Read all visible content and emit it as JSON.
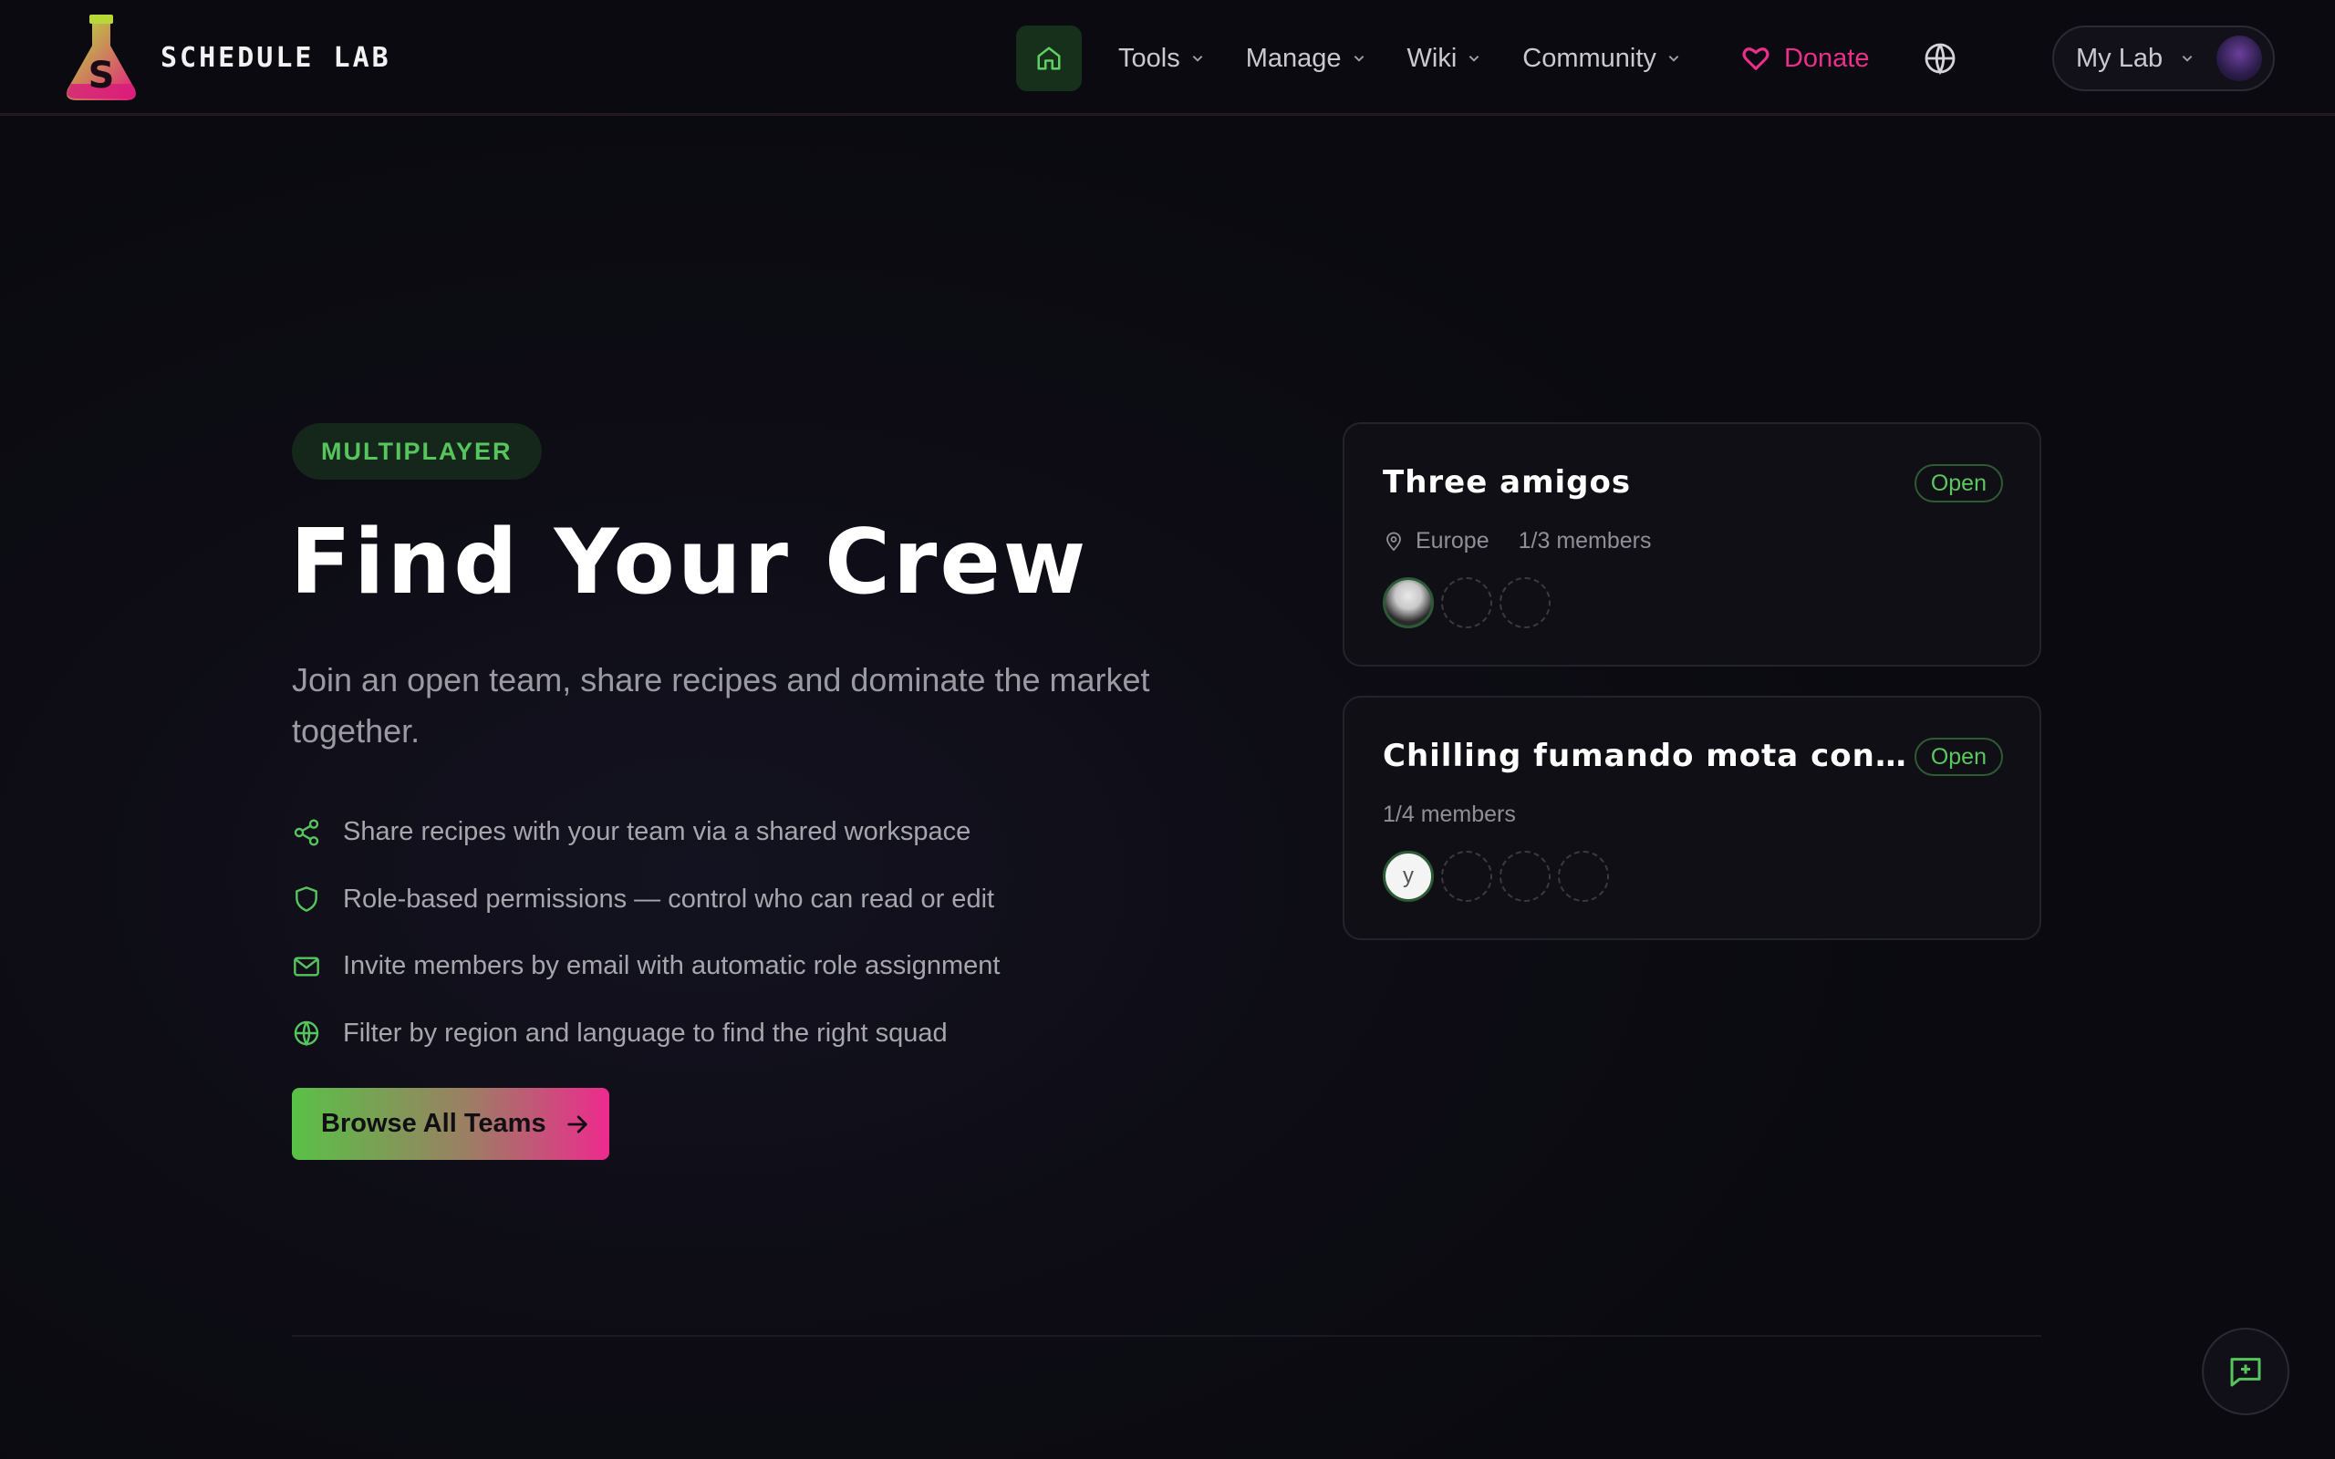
{
  "brand": {
    "name": "SCHEDULE LAB"
  },
  "nav": {
    "items": [
      {
        "label": "Tools"
      },
      {
        "label": "Manage"
      },
      {
        "label": "Wiki"
      },
      {
        "label": "Community"
      }
    ],
    "donate_label": "Donate",
    "account_label": "My Lab"
  },
  "hero": {
    "badge": "MULTIPLAYER",
    "title": "Find Your Crew",
    "subtitle": "Join an open team, share recipes and dominate the market together.",
    "features": [
      {
        "icon": "share-icon",
        "text": "Share recipes with your team via a shared workspace"
      },
      {
        "icon": "shield-icon",
        "text": "Role-based permissions — control who can read or edit"
      },
      {
        "icon": "mail-icon",
        "text": "Invite members by email with automatic role assignment"
      },
      {
        "icon": "globe-icon",
        "text": "Filter by region and language to find the right squad"
      }
    ],
    "cta_label": "Browse All Teams"
  },
  "teams": [
    {
      "name": "Three amigos",
      "status": "Open",
      "region": "Europe",
      "members": "1/3 members"
    },
    {
      "name": "Chilling fumando mota con mis…",
      "status": "Open",
      "region": "",
      "members": "1/4 members",
      "avatar_letter": "y"
    }
  ],
  "colors": {
    "accent_green": "#56c55d",
    "accent_pink": "#ec2f8a",
    "background": "#0c0b12"
  }
}
